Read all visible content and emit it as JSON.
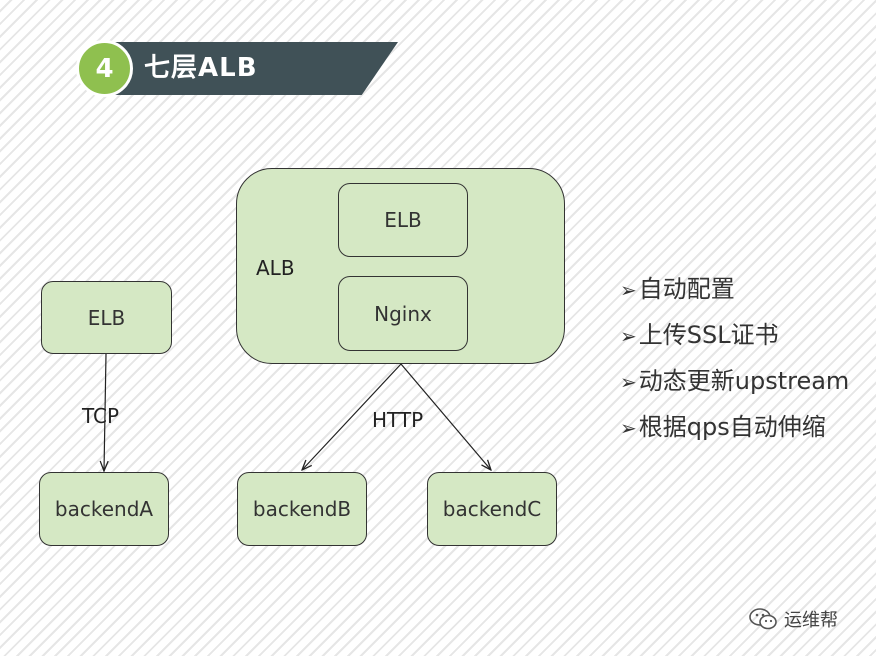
{
  "header": {
    "number": "4",
    "title": "七层ALB"
  },
  "diagram": {
    "left": {
      "elb": "ELB",
      "edge_label": "TCP",
      "backend": "backendA"
    },
    "alb": {
      "label": "ALB",
      "elb": "ELB",
      "nginx": "Nginx",
      "edge_label": "HTTP"
    },
    "backends": [
      "backendB",
      "backendC"
    ]
  },
  "features": [
    {
      "mark": "➢",
      "text": "自动配置"
    },
    {
      "mark": "➢",
      "text": "上传SSL证书"
    },
    {
      "mark": "➢",
      "text": "动态更新upstream"
    },
    {
      "mark": "➢",
      "text": "根据qps自动伸缩"
    }
  ],
  "watermark": {
    "text": "运维帮"
  },
  "colors": {
    "node_fill": "#d5e8c4",
    "banner_dark": "#405157",
    "banner_accent": "#8fc04f"
  }
}
